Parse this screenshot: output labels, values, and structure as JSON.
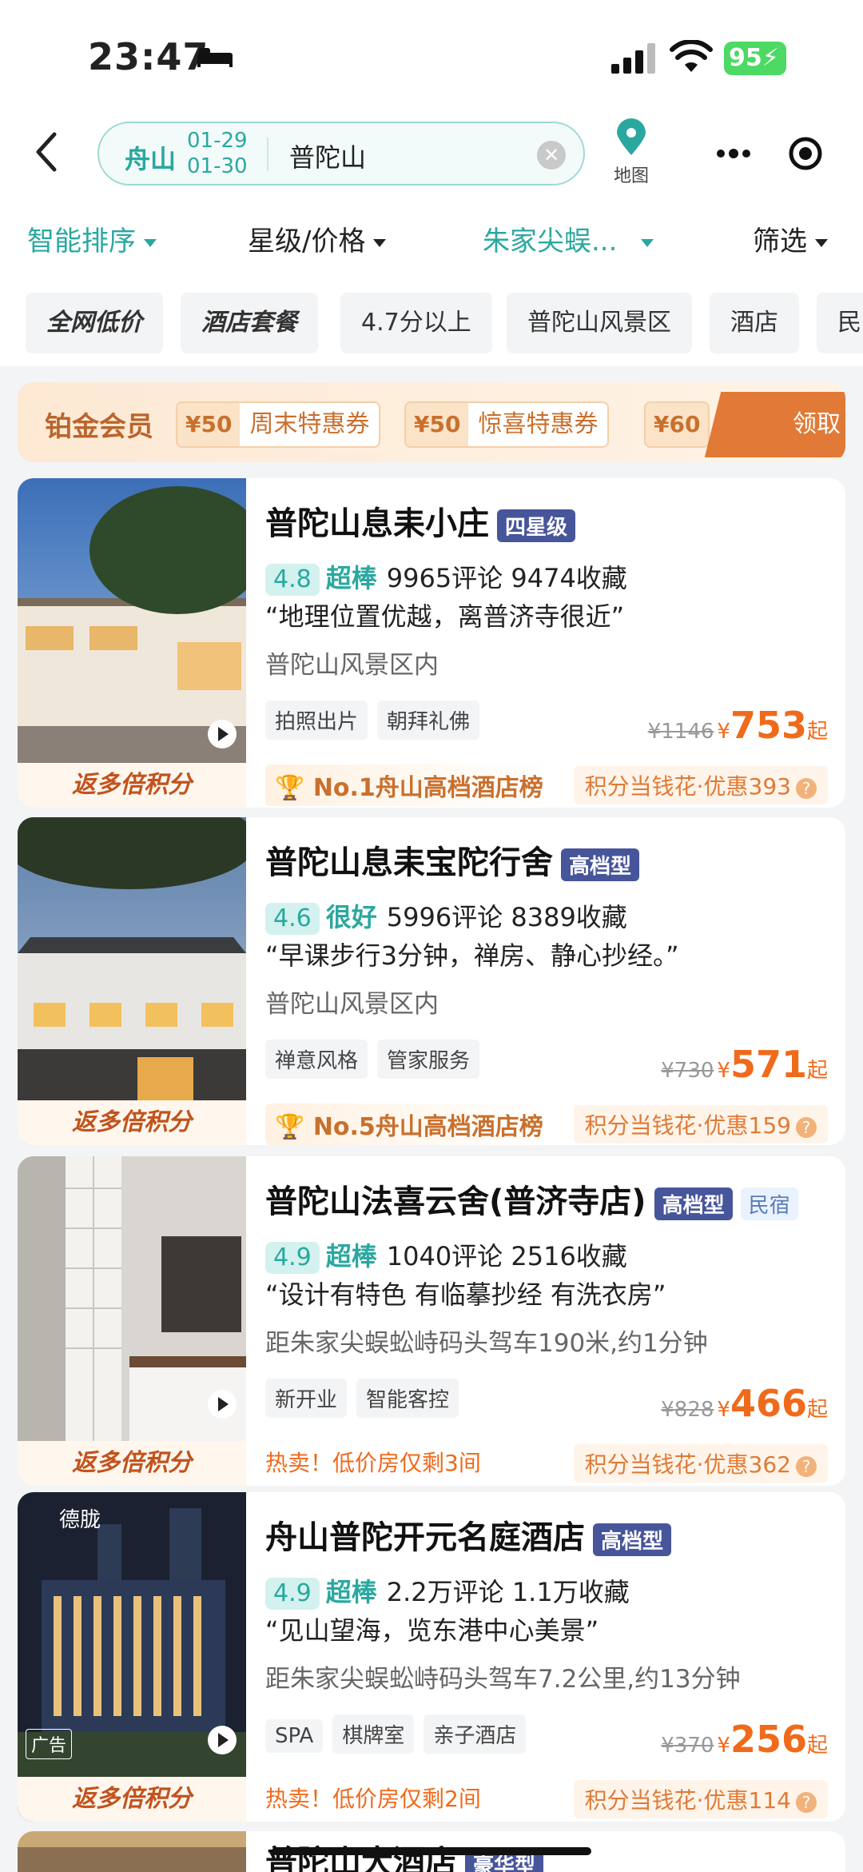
{
  "status_bar": {
    "time": "23:47",
    "battery": "95"
  },
  "search": {
    "city": "舟山",
    "checkin": "01-29",
    "checkout": "01-30",
    "keyword": "普陀山",
    "map_label": "地图"
  },
  "filters": [
    {
      "label": "智能排序",
      "active": true
    },
    {
      "label": "星级/价格",
      "active": false
    },
    {
      "label": "朱家尖蜈...",
      "active": true
    },
    {
      "label": "筛选",
      "active": false
    }
  ],
  "tags": [
    "全网低价",
    "酒店套餐",
    "4.7分以上",
    "普陀山风景区",
    "酒店",
    "民"
  ],
  "promo": {
    "title": "铂金会员",
    "coupons": [
      {
        "amount": "¥50",
        "name": "周末特惠券"
      },
      {
        "amount": "¥50",
        "name": "惊喜特惠券"
      },
      {
        "amount": "¥60",
        "name": ""
      }
    ],
    "claim": "领取 >"
  },
  "hotels": [
    {
      "name": "普陀山息耒小庄",
      "badge": "四星级",
      "badge2": "",
      "score": "4.8",
      "rating_word": "超棒",
      "reviews": "9965评论",
      "favorites": "9474收藏",
      "quote": "“地理位置优越，离普济寺很近”",
      "location": "普陀山风景区内",
      "chips": [
        "拍照出片",
        "朝拜礼佛"
      ],
      "old_price": "¥1146",
      "currency": "¥",
      "price": "753",
      "suffix": "起",
      "rank": "No.1舟山高档酒店榜",
      "hot": "",
      "points_deal": "积分当钱花·优惠393",
      "photo_label": "返多倍积分"
    },
    {
      "name": "普陀山息耒宝陀行舍",
      "badge": "高档型",
      "badge2": "",
      "score": "4.6",
      "rating_word": "很好",
      "reviews": "5996评论",
      "favorites": "8389收藏",
      "quote": "“早课步行3分钟，禅房、静心抄经。”",
      "location": "普陀山风景区内",
      "chips": [
        "禅意风格",
        "管家服务"
      ],
      "old_price": "¥730",
      "currency": "¥",
      "price": "571",
      "suffix": "起",
      "rank": "No.5舟山高档酒店榜",
      "hot": "",
      "points_deal": "积分当钱花·优惠159",
      "photo_label": "返多倍积分"
    },
    {
      "name": "普陀山法喜云舍(普济寺店)",
      "badge": "高档型",
      "badge2": "民宿",
      "score": "4.9",
      "rating_word": "超棒",
      "reviews": "1040评论",
      "favorites": "2516收藏",
      "quote": "“设计有特色 有临摹抄经 有洗衣房”",
      "location": "距朱家尖蜈蚣峙码头驾车190米,约1分钟",
      "chips": [
        "新开业",
        "智能客控"
      ],
      "old_price": "¥828",
      "currency": "¥",
      "price": "466",
      "suffix": "起",
      "rank": "",
      "hot": "热卖！低价房仅剩3间",
      "points_deal": "积分当钱花·优惠362",
      "photo_label": "返多倍积分"
    },
    {
      "name": "舟山普陀开元名庭酒店",
      "badge": "高档型",
      "badge2": "",
      "score": "4.9",
      "rating_word": "超棒",
      "reviews": "2.2万评论",
      "favorites": "1.1万收藏",
      "quote": "“见山望海，览东港中心美景”",
      "location": "距朱家尖蜈蚣峙码头驾车7.2公里,约13分钟",
      "chips": [
        "SPA",
        "棋牌室",
        "亲子酒店"
      ],
      "old_price": "¥370",
      "currency": "¥",
      "price": "256",
      "suffix": "起",
      "rank": "",
      "hot": "热卖！低价房仅剩2间",
      "points_deal": "积分当钱花·优惠114",
      "photo_label": "返多倍积分",
      "photo_sign": "德胧",
      "ad_label": "广告"
    },
    {
      "name": "普陀山大酒店",
      "badge": "豪华型"
    }
  ],
  "colors": {
    "accent": "#2aa8a0",
    "price": "#f06a1b",
    "badge": "#47559a",
    "promo": "#e07a36"
  }
}
